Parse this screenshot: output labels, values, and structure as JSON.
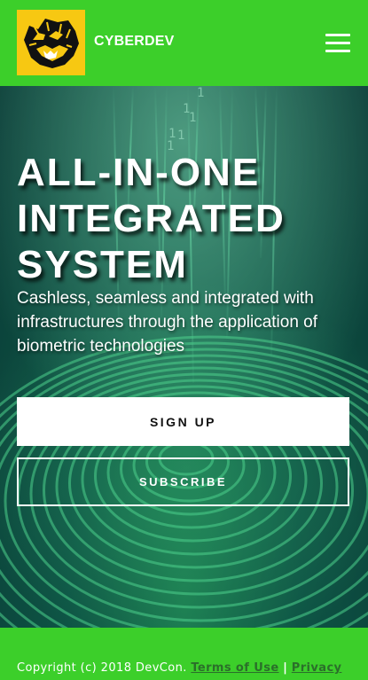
{
  "header": {
    "brand": "CYBERDEV",
    "logo_icon": "tiger-logo-icon",
    "menu_icon": "hamburger-menu-icon"
  },
  "hero": {
    "title": "ALL-IN-ONE INTEGRATED SYSTEM",
    "subtitle": "Cashless, seamless and integrated with infrastructures through the application of biometric technologies",
    "signup_label": "SIGN UP",
    "subscribe_label": "SUBSCRIBE"
  },
  "footer": {
    "copyright": "Copyright (c) 2018 DevCon.",
    "terms_label": "Terms of Use",
    "separator": "|",
    "privacy_label": "Privacy"
  },
  "colors": {
    "brand_green": "#3ccf2a",
    "logo_yellow": "#f7c812",
    "hero_teal": "#0f5a48",
    "link_dark_green": "#2b6f2a"
  }
}
